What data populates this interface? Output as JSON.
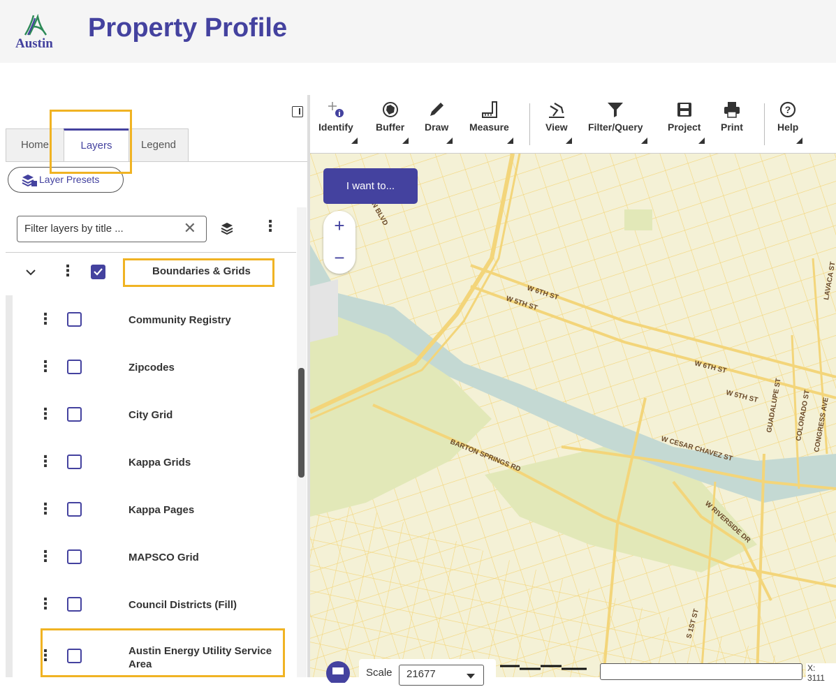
{
  "header": {
    "logo_text": "Austin",
    "title": "Property Profile"
  },
  "panel": {
    "tabs": [
      {
        "label": "Home"
      },
      {
        "label": "Layers"
      },
      {
        "label": "Legend"
      }
    ],
    "presets_label": "Layer Presets",
    "filter_placeholder": "Filter layers by title ...",
    "group": {
      "label": "Boundaries & Grids",
      "checked": true
    },
    "layers": [
      {
        "label": "Community Registry",
        "checked": false
      },
      {
        "label": "Zipcodes",
        "checked": false
      },
      {
        "label": "City Grid",
        "checked": false
      },
      {
        "label": "Kappa Grids",
        "checked": false
      },
      {
        "label": "Kappa Pages",
        "checked": false
      },
      {
        "label": "MAPSCO Grid",
        "checked": false
      },
      {
        "label": "Council Districts (Fill)",
        "checked": false
      },
      {
        "label": "Austin Energy Utility Service Area",
        "checked": false
      }
    ]
  },
  "toolbar": {
    "tools": [
      {
        "label": "Identify",
        "icon": "identify-icon"
      },
      {
        "label": "Buffer",
        "icon": "buffer-icon"
      },
      {
        "label": "Draw",
        "icon": "pencil-icon"
      },
      {
        "label": "Measure",
        "icon": "ruler-icon"
      },
      {
        "label": "View",
        "icon": "view-icon"
      },
      {
        "label": "Filter/Query",
        "icon": "filter-icon"
      },
      {
        "label": "Project",
        "icon": "save-icon"
      },
      {
        "label": "Print",
        "icon": "printer-icon"
      },
      {
        "label": "Help",
        "icon": "help-icon"
      }
    ]
  },
  "map": {
    "i_want_to": "I want to...",
    "zoom_in": "+",
    "zoom_out": "−",
    "street_labels": [
      {
        "text": "W 6TH ST"
      },
      {
        "text": "W 5TH ST"
      },
      {
        "text": "W 6TH ST"
      },
      {
        "text": "W 5TH ST"
      },
      {
        "text": "BARTON SPRINGS RD"
      },
      {
        "text": "W CESAR CHAVEZ ST"
      },
      {
        "text": "W RIVERSIDE DR"
      },
      {
        "text": "GUADALUPE ST"
      },
      {
        "text": "COLORADO ST"
      },
      {
        "text": "CONGRESS AVE"
      },
      {
        "text": "LAVACA ST"
      },
      {
        "text": "S 1ST ST"
      },
      {
        "text": "N BLVD"
      }
    ],
    "scale_label": "Scale",
    "scale_value": "21677",
    "coord_text": "X: 3111"
  },
  "colors": {
    "brand": "#44429f",
    "highlight": "#f0b323",
    "map_bg": "#f4f1d6",
    "river": "#c4d9d3",
    "park": "#e2e8b8",
    "road": "#f3d57a"
  }
}
